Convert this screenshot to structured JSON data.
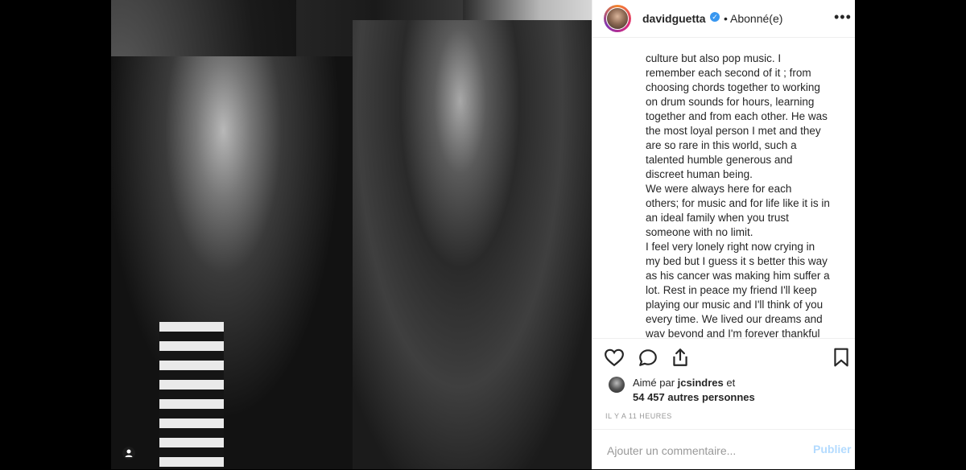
{
  "post": {
    "username": "davidguetta",
    "follow_status": "• Abonné(e)",
    "more_icon": "more-horizontal-icon"
  },
  "caption": {
    "lines": [
      "culture but also pop music. I",
      "remember each second of it ; from",
      "choosing chords together to working",
      "on drum sounds for hours, learning",
      "together and from each other. He was",
      "the most loyal person I met and they",
      "are so rare in this world, such a",
      "talented humble generous and",
      "discreet human being.",
      "We were always here for each",
      "others; for music and for life like it is in",
      "an ideal family when you trust",
      "someone with no limit.",
      "I feel very lonely right now crying in",
      "my bed  but I guess it s better this way",
      "as his cancer was making him suffer a",
      "lot. Rest in peace my friend I'll keep",
      "playing our music and I'll think of you",
      "every time. We lived our dreams and",
      "way beyond and I'm forever thankful"
    ]
  },
  "actions": {
    "like_icon": "heart-icon",
    "comment_icon": "comment-icon",
    "share_icon": "share-icon",
    "save_icon": "bookmark-icon"
  },
  "likes": {
    "prefix": "Aimé par ",
    "user": "jcsindres",
    "suffix": " et",
    "count": "54 457 autres personnes"
  },
  "timestamp": "IL Y A 11 HEURES",
  "comment": {
    "placeholder": "Ajouter un commentaire...",
    "publish": "Publier"
  }
}
